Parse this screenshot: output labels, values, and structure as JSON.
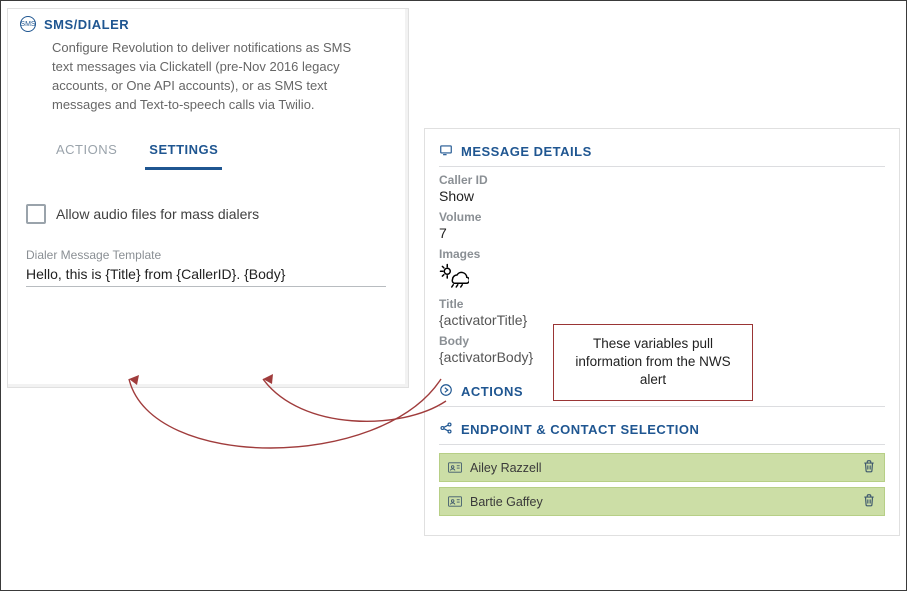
{
  "left": {
    "title": "SMS/DIALER",
    "description": "Configure Revolution to deliver notifications as SMS text messages via Clickatell (pre-Nov 2016 legacy accounts, or One API accounts), or as SMS text messages and Text-to-speech calls via Twilio.",
    "tabs": {
      "actions": "ACTIONS",
      "settings": "SETTINGS"
    },
    "checkbox_label": "Allow audio files for mass dialers",
    "template_label": "Dialer Message Template",
    "template_value": "Hello, this is {Title} from {CallerID}. {Body}"
  },
  "right": {
    "header": "MESSAGE DETAILS",
    "caller_id_k": "Caller ID",
    "caller_id_v": "Show",
    "volume_k": "Volume",
    "volume_v": "7",
    "images_k": "Images",
    "title_k": "Title",
    "title_v": "{activatorTitle}",
    "body_k": "Body",
    "body_v": "{activatorBody}",
    "actions_header": "ACTIONS",
    "endpoint_header": "ENDPOINT & CONTACT SELECTION",
    "contacts": [
      "Ailey Razzell",
      "Bartie Gaffey"
    ]
  },
  "callout": "These variables pull information from the NWS alert"
}
